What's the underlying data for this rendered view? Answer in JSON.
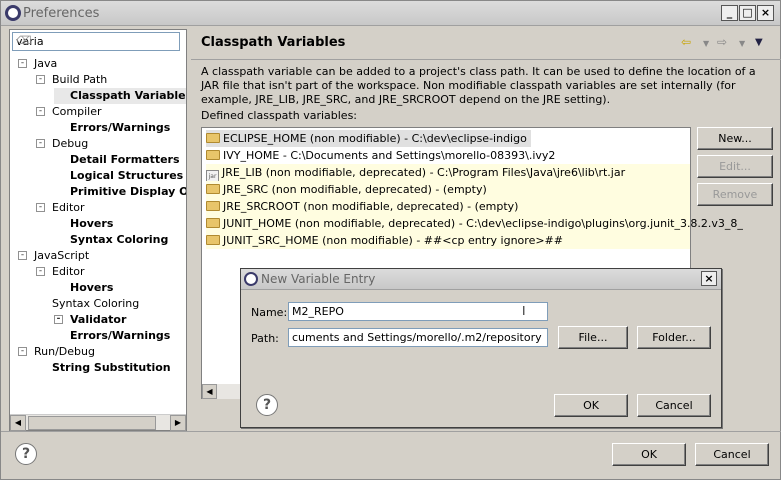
{
  "window": {
    "title": "Preferences"
  },
  "filter": {
    "value": "varia"
  },
  "tree": [
    {
      "label": "Java",
      "expander": "-"
    },
    {
      "label": "Build Path",
      "expander": "-"
    },
    {
      "label": "Classpath Variables"
    },
    {
      "label": "Compiler",
      "expander": "-"
    },
    {
      "label": "Errors/Warnings"
    },
    {
      "label": "Debug",
      "expander": "-"
    },
    {
      "label": "Detail Formatters"
    },
    {
      "label": "Logical Structures"
    },
    {
      "label": "Primitive Display Options"
    },
    {
      "label": "Editor",
      "expander": "-"
    },
    {
      "label": "Hovers"
    },
    {
      "label": "Syntax Coloring"
    },
    {
      "label": "JavaScript",
      "expander": "-"
    },
    {
      "label": "Editor",
      "expander": "-"
    },
    {
      "label": "Hovers"
    },
    {
      "label": "Syntax Coloring"
    },
    {
      "label": "Validator",
      "expander": "-"
    },
    {
      "label": "Errors/Warnings"
    },
    {
      "label": "Run/Debug",
      "expander": "-"
    },
    {
      "label": "String Substitution"
    }
  ],
  "page": {
    "title": "Classpath Variables",
    "description": "A classpath variable can be added to a project's class path. It can be used to define the location of a JAR file that isn't part of the workspace. Non modifiable classpath variables are set internally (for example, JRE_LIB, JRE_SRC, and JRE_SRCROOT depend on the JRE setting).",
    "defined_label": "Defined classpath variables:",
    "variables": [
      {
        "text": "ECLIPSE_HOME (non modifiable) - C:\\dev\\eclipse-indigo",
        "icon": "folder"
      },
      {
        "text": "IVY_HOME - C:\\Documents and Settings\\morello-08393\\.ivy2",
        "icon": "folder"
      },
      {
        "text": "JRE_LIB (non modifiable, deprecated) - C:\\Program Files\\Java\\jre6\\lib\\rt.jar",
        "icon": "jar"
      },
      {
        "text": "JRE_SRC (non modifiable, deprecated) - (empty)",
        "icon": "folder-edit"
      },
      {
        "text": "JRE_SRCROOT (non modifiable, deprecated) - (empty)",
        "icon": "folder-edit"
      },
      {
        "text": "JUNIT_HOME (non modifiable, deprecated) - C:\\dev\\eclipse-indigo\\plugins\\org.junit_3.8.2.v3_8_",
        "icon": "folder-edit"
      },
      {
        "text": "JUNIT_SRC_HOME (non modifiable) - ##<cp entry ignore>##",
        "icon": "folder"
      }
    ],
    "buttons": {
      "new": "New...",
      "edit": "Edit...",
      "remove": "Remove"
    }
  },
  "footer": {
    "ok": "OK",
    "cancel": "Cancel"
  },
  "dialog": {
    "title": "New Variable Entry",
    "name_label": "Name:",
    "name_value": "M2_REPO",
    "path_label": "Path:",
    "path_value": "cuments and Settings/morello/.m2/repository",
    "file_button": "File...",
    "folder_button": "Folder...",
    "ok": "OK",
    "cancel": "Cancel"
  }
}
